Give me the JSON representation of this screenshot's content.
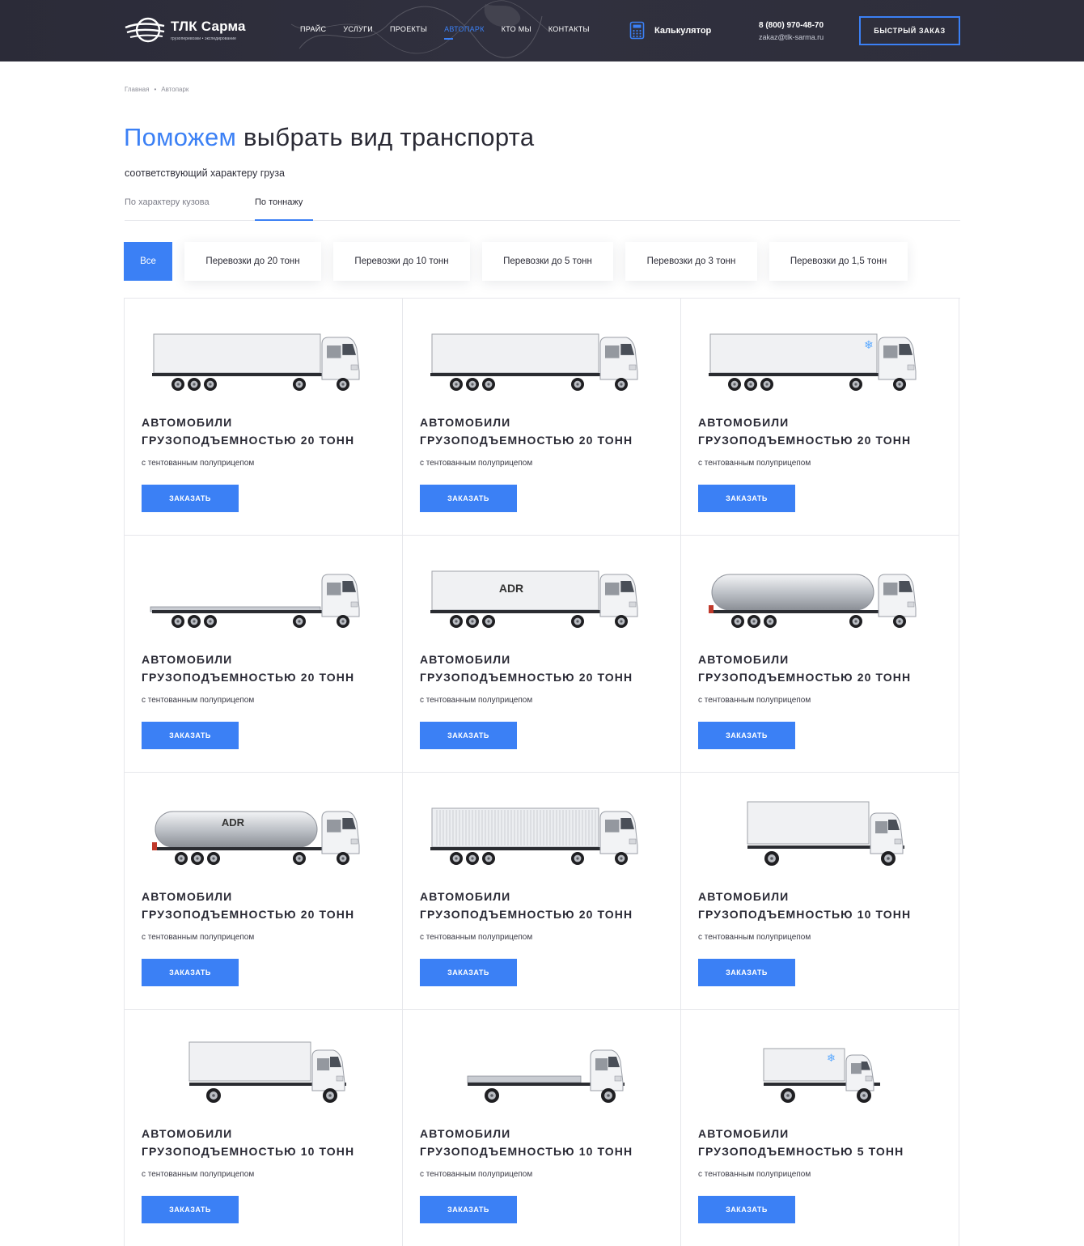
{
  "header": {
    "logo_title": "ТЛК Сарма",
    "logo_subtitle": "грузоперевозки • экспедирование",
    "nav": [
      "Прайс",
      "Услуги",
      "Проекты",
      "Автопарк",
      "Кто мы",
      "Контакты"
    ],
    "nav_active_index": 3,
    "calculator_label": "Калькулятор",
    "phone": "8 (800) 970-48-70",
    "email": "zakaz@tlk-sarma.ru",
    "quick_order_label": "Быстрый заказ"
  },
  "breadcrumb": [
    "Главная",
    "Автопарк"
  ],
  "title": {
    "accent": "Поможем",
    "rest": " выбрать вид транспорта"
  },
  "subtitle": "соответствующий характеру груза",
  "tabs": [
    "По характеру кузова",
    "По тоннажу"
  ],
  "active_tab_index": 1,
  "filters": [
    "Все",
    "Перевозки до 20 тонн",
    "Перевозки до 10 тонн",
    "Перевозки до 5 тонн",
    "Перевозки до 3 тонн",
    "Перевозки до 1,5 тонн"
  ],
  "active_filter_index": 0,
  "colors": {
    "accent": "#3b80f5",
    "header_bg": "#2e2e3b",
    "text": "#2a2a35"
  },
  "cards": [
    {
      "title_line1": "Автомобили",
      "title_line2": "грузоподъемностью 20 тонн",
      "desc": "с тентованным полуприцепом",
      "button": "Заказать",
      "vehicle": "tent-semitrailer-truck-icon"
    },
    {
      "title_line1": "Автомобили",
      "title_line2": "грузоподъемностью 20 тонн",
      "desc": "с тентованным полуприцепом",
      "button": "Заказать",
      "vehicle": "box-semitrailer-truck-icon"
    },
    {
      "title_line1": "Автомобили",
      "title_line2": "грузоподъемностью 20 тонн",
      "desc": "с тентованным полуприцепом",
      "button": "Заказать",
      "vehicle": "refrigerated-semitrailer-truck-icon"
    },
    {
      "title_line1": "Автомобили",
      "title_line2": "грузоподъемностью 20 тонн",
      "desc": "с тентованным полуприцепом",
      "button": "Заказать",
      "vehicle": "flatbed-semitrailer-truck-icon"
    },
    {
      "title_line1": "Автомобили",
      "title_line2": "грузоподъемностью 20 тонн",
      "desc": "с тентованным полуприцепом",
      "button": "Заказать",
      "vehicle": "adr-box-semitrailer-truck-icon",
      "label": "ADR"
    },
    {
      "title_line1": "Автомобили",
      "title_line2": "грузоподъемностью 20 тонн",
      "desc": "с тентованным полуприцепом",
      "button": "Заказать",
      "vehicle": "tanker-truck-icon"
    },
    {
      "title_line1": "Автомобили",
      "title_line2": "грузоподъемностью 20 тонн",
      "desc": "с тентованным полуприцепом",
      "button": "Заказать",
      "vehicle": "adr-tanker-truck-icon",
      "label": "ADR"
    },
    {
      "title_line1": "Автомобили",
      "title_line2": "грузоподъемностью 20 тонн",
      "desc": "с тентованным полуприцепом",
      "button": "Заказать",
      "vehicle": "container-semitrailer-truck-icon"
    },
    {
      "title_line1": "Автомобили",
      "title_line2": "грузоподъемностью 10 тонн",
      "desc": "с тентованным полуприцепом",
      "button": "Заказать",
      "vehicle": "box-truck-10t-icon"
    },
    {
      "title_line1": "Автомобили",
      "title_line2": "грузоподъемностью 10 тонн",
      "desc": "с тентованным полуприцепом",
      "button": "Заказать",
      "vehicle": "box-truck-10t-small-icon"
    },
    {
      "title_line1": "Автомобили",
      "title_line2": "грузоподъемностью 10 тонн",
      "desc": "с тентованным полуприцепом",
      "button": "Заказать",
      "vehicle": "flatbed-truck-icon"
    },
    {
      "title_line1": "Автомобили",
      "title_line2": "грузоподъемностью 5 тонн",
      "desc": "с тентованным полуприцепом",
      "button": "Заказать",
      "vehicle": "refrigerated-truck-5t-icon"
    }
  ]
}
